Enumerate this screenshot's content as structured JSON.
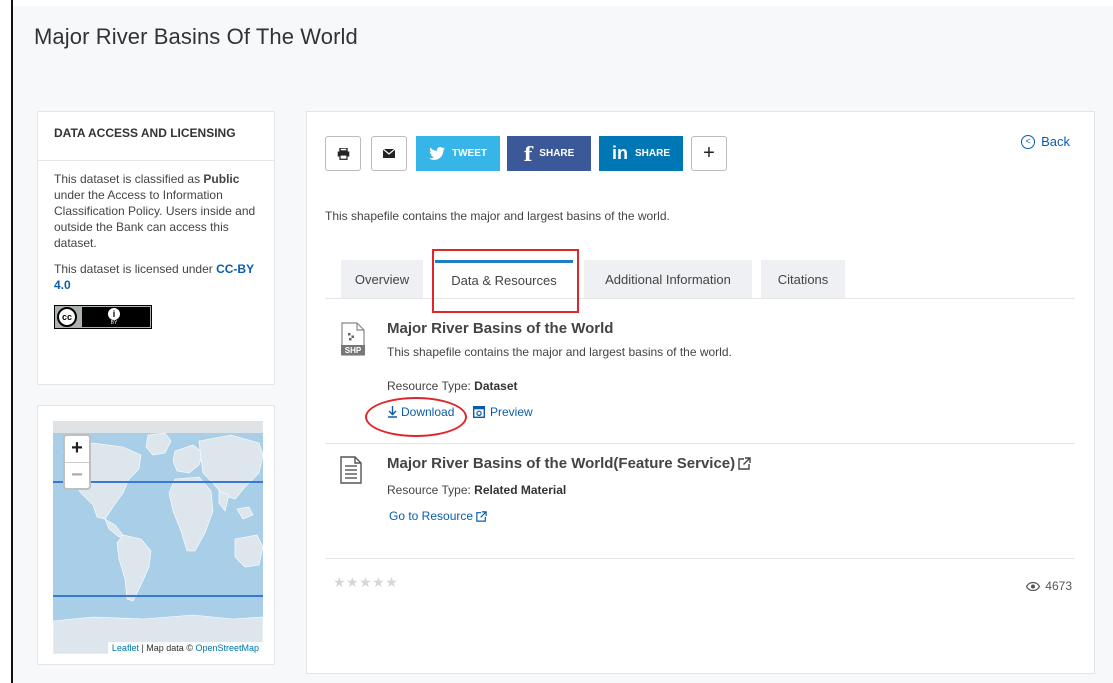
{
  "page": {
    "title": "Major River Basins Of The World"
  },
  "license": {
    "heading": "DATA ACCESS AND LICENSING",
    "para1_prefix": "This dataset is classified as ",
    "para1_bold": "Public",
    "para1_suffix": " under the Access to Information Classification Policy. Users inside and outside the Bank can access this dataset.",
    "para2_prefix": "This dataset is licensed under ",
    "para2_link": "CC-BY 4.0",
    "badge_cc": "cc",
    "badge_by": "BY"
  },
  "map": {
    "zoom_in": "+",
    "zoom_out": "−",
    "attribution_leaflet": "Leaflet",
    "attribution_text": " | Map data © ",
    "attribution_osm": "OpenStreetMap"
  },
  "share": {
    "tweet": "TWEET",
    "facebook": "SHARE",
    "linkedin": "SHARE",
    "more": "+"
  },
  "back": {
    "label": "Back"
  },
  "dataset": {
    "description": "This shapefile contains the major and largest basins of the world."
  },
  "tabs": [
    {
      "label": "Overview",
      "active": false
    },
    {
      "label": "Data & Resources",
      "active": true
    },
    {
      "label": "Additional Information",
      "active": false
    },
    {
      "label": "Citations",
      "active": false
    }
  ],
  "resources": [
    {
      "icon_label": "SHP",
      "title": "Major River Basins of the World",
      "description": "This shapefile contains the major and largest basins of the world.",
      "type_prefix": "Resource Type: ",
      "type_value": "Dataset",
      "download_label": "Download",
      "preview_label": "Preview"
    },
    {
      "title": "Major River Basins of the World(Feature Service)",
      "type_prefix": "Resource Type: ",
      "type_value": "Related Material",
      "link_label": "Go to Resource"
    }
  ],
  "rating": {
    "stars": "★★★★★"
  },
  "views": {
    "count": "4673"
  },
  "colors": {
    "accent_link": "#0b5cad",
    "twitter": "#35b5e8",
    "facebook": "#3b5998",
    "linkedin": "#0077b5",
    "annotation_red": "#e0262b",
    "active_tab": "#1d7ec2"
  }
}
